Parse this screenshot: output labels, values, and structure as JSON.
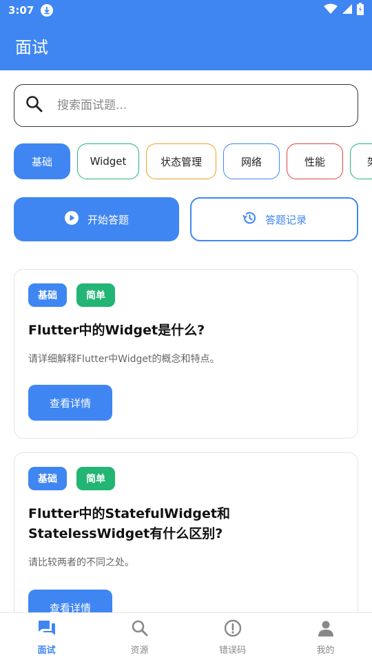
{
  "status": {
    "time": "3:07"
  },
  "appbar": {
    "title": "面试"
  },
  "search": {
    "placeholder": "搜索面试题..."
  },
  "categories": [
    {
      "label": "基础",
      "active": true
    },
    {
      "label": "Widget"
    },
    {
      "label": "状态管理"
    },
    {
      "label": "网络"
    },
    {
      "label": "性能"
    },
    {
      "label": "架"
    }
  ],
  "actions": {
    "start": "开始答题",
    "history": "答题记录"
  },
  "questions": [
    {
      "tags": [
        "基础",
        "简单"
      ],
      "title": "Flutter中的Widget是什么?",
      "desc": "请详细解释Flutter中Widget的概念和特点。",
      "button": "查看详情"
    },
    {
      "tags": [
        "基础",
        "简单"
      ],
      "title": "Flutter中的StatefulWidget和StatelessWidget有什么区别?",
      "desc": "请比较两者的不同之处。",
      "button": "查看详情"
    }
  ],
  "nav": [
    {
      "label": "面试",
      "icon": "chat-icon",
      "active": true
    },
    {
      "label": "资源",
      "icon": "search-icon"
    },
    {
      "label": "错误码",
      "icon": "alert-circle-icon"
    },
    {
      "label": "我的",
      "icon": "person-icon"
    }
  ],
  "colors": {
    "primary": "#3f86f2",
    "green": "#22b573",
    "orange": "#f0a020",
    "red": "#e04040"
  }
}
